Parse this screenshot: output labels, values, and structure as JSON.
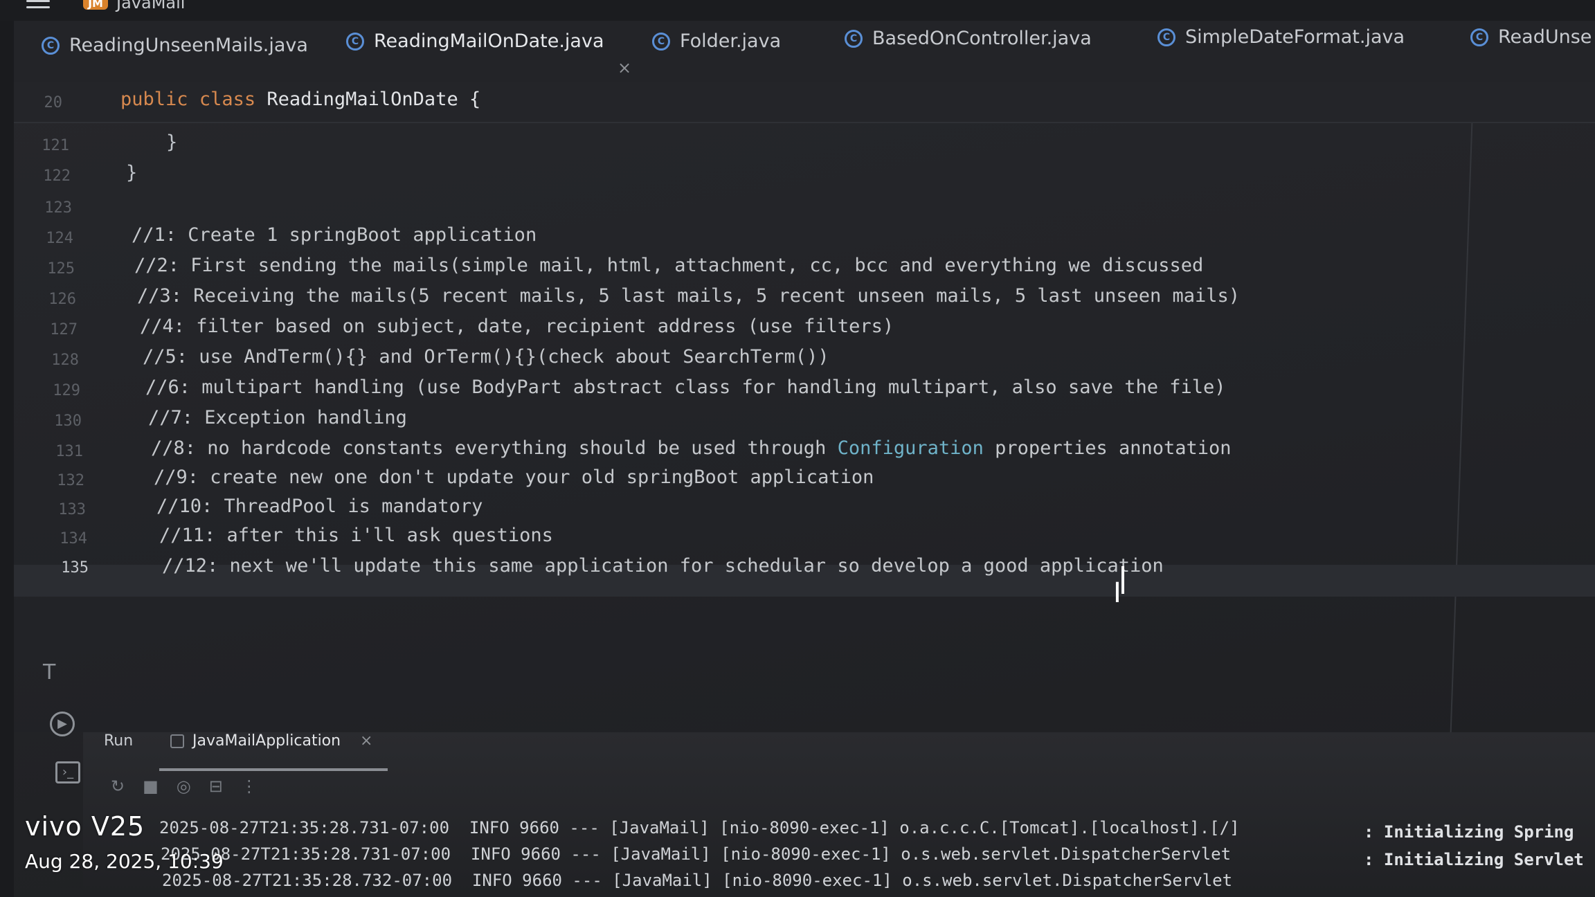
{
  "app": {
    "project_badge": "JM",
    "project_name": "JavaMail"
  },
  "tabs": [
    {
      "label": "ReadingUnseenMails.java",
      "active": false
    },
    {
      "label": "ReadingMailOnDate.java",
      "active": true
    },
    {
      "label": "Folder.java",
      "active": false
    },
    {
      "label": "BasedOnController.java",
      "active": false
    },
    {
      "label": "SimpleDateFormat.java",
      "active": false
    },
    {
      "label": "ReadUnse",
      "active": false
    }
  ],
  "tab_close_glyph": "×",
  "editor": {
    "sticky_header": {
      "line_number": "20",
      "keyword_public": "public",
      "keyword_class": "class",
      "class_name": "ReadingMailOnDate {"
    },
    "lines": [
      {
        "num": "121",
        "text": "}"
      },
      {
        "num": "122",
        "text": "}"
      },
      {
        "num": "123",
        "text": ""
      },
      {
        "num": "124",
        "text": "//1: Create 1 springBoot application"
      },
      {
        "num": "125",
        "text": "//2: First sending the mails(simple mail, html, attachment, cc, bcc and everything we discussed"
      },
      {
        "num": "126",
        "text": "//3: Receiving the mails(5 recent mails, 5 last mails, 5 recent unseen mails, 5 last unseen mails)"
      },
      {
        "num": "127",
        "text": "//4: filter based on subject, date, recipient address (use filters)"
      },
      {
        "num": "128",
        "text": "//5: use AndTerm(){} and OrTerm(){}(check about SearchTerm())"
      },
      {
        "num": "129",
        "text": "//6: multipart handling (use BodyPart abstract class for handling multipart, also save the file)"
      },
      {
        "num": "130",
        "text": "//7: Exception handling"
      },
      {
        "num": "131",
        "text_before": "//8: no hardcode constants everything should be used through ",
        "highlight": "Configuration",
        "text_after": " properties annotation"
      },
      {
        "num": "132",
        "text": "//9: create new one don't update your old springBoot application"
      },
      {
        "num": "133",
        "text": "//10: ThreadPool is mandatory"
      },
      {
        "num": "134",
        "text": "//11: after this i'll ask questions"
      },
      {
        "num": "135",
        "text": "//12: next we'll update this same application for schedular so develop a good application",
        "current": true
      }
    ]
  },
  "run_panel": {
    "label": "Run",
    "tab_label": "JavaMailApplication",
    "close_glyph": "×",
    "toolbar_icons": [
      "rerun-icon",
      "stop-icon",
      "camera-icon",
      "layout-icon",
      "more-icon"
    ],
    "logs": [
      {
        "text": "2025-08-27T21:35:28.731-07:00  INFO 9660 --- [JavaMail] [nio-8090-exec-1] o.a.c.c.C.[Tomcat].[localhost].[/]",
        "right": ": Initializing Spring"
      },
      {
        "text": "2025-08-27T21:35:28.731-07:00  INFO 9660 --- [JavaMail] [nio-8090-exec-1] o.s.web.servlet.DispatcherServlet",
        "right": ": Initializing Servlet"
      },
      {
        "text": "2025-08-27T21:35:28.732-07:00  INFO 9660 --- [JavaMail] [nio-8090-exec-1] o.s.web.servlet.DispatcherServlet",
        "right": ""
      }
    ]
  },
  "watermark": {
    "model": "vivo V25",
    "date": "Aug 28, 2025, 10:39"
  },
  "colors": {
    "accent": "#4a8df0",
    "keyword": "#d7894f",
    "class_icon": "#5a8fd6"
  }
}
